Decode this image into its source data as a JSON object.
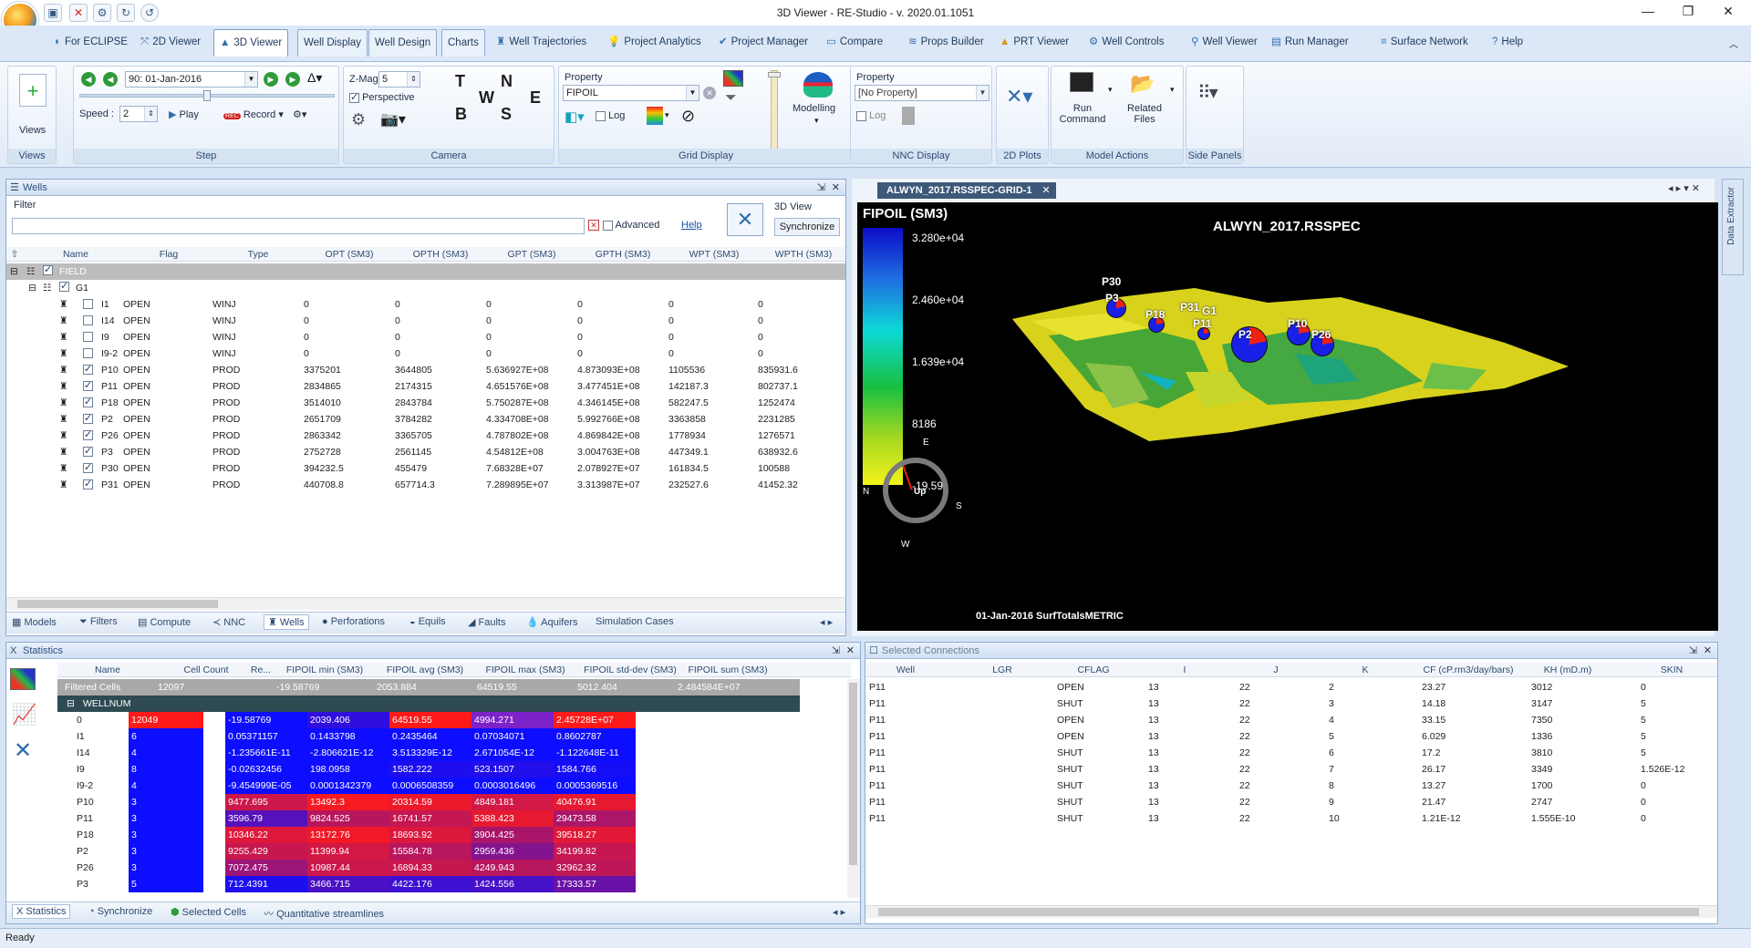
{
  "window": {
    "title": "3D Viewer - RE-Studio - v. 2020.01.1051"
  },
  "tabs": [
    {
      "label": "For ECLIPSE",
      "icon": "eclipse-icon"
    },
    {
      "label": "2D Viewer",
      "icon": "2d-viewer-icon"
    },
    {
      "label": "3D Viewer",
      "icon": "3d-viewer-icon"
    },
    {
      "label": "Well Display",
      "icon": ""
    },
    {
      "label": "Well Design",
      "icon": ""
    },
    {
      "label": "Charts",
      "icon": ""
    },
    {
      "label": "Well Trajectories",
      "icon": "derrick-icon"
    },
    {
      "label": "Project Analytics",
      "icon": "bulb-icon"
    },
    {
      "label": "Project Manager",
      "icon": "manager-icon"
    },
    {
      "label": "Compare",
      "icon": "compare-icon"
    },
    {
      "label": "Props Builder",
      "icon": "props-icon"
    },
    {
      "label": "PRT Viewer",
      "icon": "prt-icon"
    },
    {
      "label": "Well Controls",
      "icon": "controls-icon"
    },
    {
      "label": "Well Viewer",
      "icon": "well-viewer-icon"
    },
    {
      "label": "Run Manager",
      "icon": "server-icon"
    },
    {
      "label": "Surface Network",
      "icon": "network-icon"
    },
    {
      "label": "Help",
      "icon": "help-icon"
    }
  ],
  "ribbon": {
    "views_label": "Views",
    "views_group": "Views",
    "step_date": "90: 01-Jan-2016",
    "speed_label": "Speed :",
    "speed_value": "2",
    "play_label": "Play",
    "record_label": "Record",
    "step_group": "Step",
    "zmag_label": "Z-Mag",
    "zmag_value": "5",
    "perspective_label": "Perspective",
    "compass_letters": [
      "T",
      "B",
      "W",
      "N",
      "S",
      "E"
    ],
    "camera_group": "Camera",
    "property_label": "Property",
    "property_value": "FIPOIL",
    "log_label": "Log",
    "modelling_label": "Modelling",
    "grid_group": "Grid Display",
    "nnc_property_label": "Property",
    "nnc_property_value": "[No Property]",
    "nnc_log_label": "Log",
    "nnc_group": "NNC Display",
    "plots_group": "2D Plots",
    "run_command": "Run\nCommand",
    "related_files": "Related\nFiles",
    "actions_group": "Model Actions",
    "side_group": "Side Panels"
  },
  "wells_panel": {
    "title": "Wells",
    "filter_label": "Filter",
    "filter_value": "",
    "advanced_label": "Advanced",
    "help_label": "Help",
    "view_label": "3D View",
    "sync_label": "Synchronize",
    "columns": [
      "Name",
      "Flag",
      "Type",
      "OPT (SM3)",
      "OPTH (SM3)",
      "GPT (SM3)",
      "GPTH (SM3)",
      "WPT (SM3)",
      "WPTH (SM3)"
    ],
    "field_label": "FIELD",
    "group_label": "G1",
    "rows": [
      [
        "I1",
        "OPEN",
        "WINJ",
        "0",
        "0",
        "0",
        "0",
        "0",
        "0"
      ],
      [
        "I14",
        "OPEN",
        "WINJ",
        "0",
        "0",
        "0",
        "0",
        "0",
        "0"
      ],
      [
        "I9",
        "OPEN",
        "WINJ",
        "0",
        "0",
        "0",
        "0",
        "0",
        "0"
      ],
      [
        "I9-2",
        "OPEN",
        "WINJ",
        "0",
        "0",
        "0",
        "0",
        "0",
        "0"
      ],
      [
        "P10",
        "OPEN",
        "PROD",
        "3375201",
        "3644805",
        "5.636927E+08",
        "4.873093E+08",
        "1105536",
        "835931.6"
      ],
      [
        "P11",
        "OPEN",
        "PROD",
        "2834865",
        "2174315",
        "4.651576E+08",
        "3.477451E+08",
        "142187.3",
        "802737.1"
      ],
      [
        "P18",
        "OPEN",
        "PROD",
        "3514010",
        "2843784",
        "5.750287E+08",
        "4.346145E+08",
        "582247.5",
        "1252474"
      ],
      [
        "P2",
        "OPEN",
        "PROD",
        "2651709",
        "3784282",
        "4.334708E+08",
        "5.992766E+08",
        "3363858",
        "2231285"
      ],
      [
        "P26",
        "OPEN",
        "PROD",
        "2863342",
        "3365705",
        "4.787802E+08",
        "4.869842E+08",
        "1778934",
        "1276571"
      ],
      [
        "P3",
        "OPEN",
        "PROD",
        "2752728",
        "2561145",
        "4.54812E+08",
        "3.004763E+08",
        "447349.1",
        "638932.6"
      ],
      [
        "P30",
        "OPEN",
        "PROD",
        "394232.5",
        "455479",
        "7.68328E+07",
        "2.078927E+07",
        "161834.5",
        "100588"
      ],
      [
        "P31",
        "OPEN",
        "PROD",
        "440708.8",
        "657714.3",
        "7.289895E+07",
        "3.313987E+07",
        "232527.6",
        "41452.32"
      ]
    ],
    "checked": [
      false,
      false,
      false,
      false,
      true,
      true,
      true,
      true,
      true,
      true,
      true,
      true
    ],
    "bottom_tabs": [
      "Models",
      "Filters",
      "Compute",
      "NNC",
      "Wells",
      "Perforations",
      "Equils",
      "Faults",
      "Aquifers",
      "Simulation Cases"
    ]
  },
  "viewer": {
    "tab_label": "ALWYN_2017.RSSPEC-GRID-1",
    "property_title": "FIPOIL (SM3)",
    "model_title": "ALWYN_2017.RSSPEC",
    "legend": [
      "3.280e+04",
      "2.460e+04",
      "1.639e+04",
      "8186",
      "-19.59"
    ],
    "footer": "01-Jan-2016 SurfTotalsMETRIC",
    "compass": {
      "n": "N",
      "e": "E",
      "s": "S",
      "w": "W",
      "up": "Up"
    },
    "wells": [
      "P30",
      "P3",
      "P18",
      "P31",
      "G1",
      "P11",
      "P2",
      "P10",
      "P26"
    ],
    "side_label": "Data Extractor"
  },
  "stats_panel": {
    "title": "Statistics",
    "columns": [
      "Name",
      "Cell Count",
      "Re...",
      "FIPOIL min (SM3)",
      "FIPOIL avg (SM3)",
      "FIPOIL max (SM3)",
      "FIPOIL std-dev (SM3)",
      "FIPOIL sum (SM3)"
    ],
    "filtered": [
      "Filtered Cells",
      "12097",
      "",
      "-19.58769",
      "2053.884",
      "64519.55",
      "5012.404",
      "2.484584E+07"
    ],
    "group": "WELLNUM",
    "rows": [
      [
        "0",
        "12049",
        "",
        "-19.58769",
        "2039.406",
        "64519.55",
        "4994.271",
        "2.45728E+07"
      ],
      [
        "I1",
        "6",
        "",
        "0.05371157",
        "0.1433798",
        "0.2435464",
        "0.07034071",
        "0.8602787"
      ],
      [
        "I14",
        "4",
        "",
        "-1.235661E-11",
        "-2.806621E-12",
        "3.513329E-12",
        "2.671054E-12",
        "-1.122648E-11"
      ],
      [
        "I9",
        "8",
        "",
        "-0.02632456",
        "198.0958",
        "1582.222",
        "523.1507",
        "1584.766"
      ],
      [
        "I9-2",
        "4",
        "",
        "-9.454999E-05",
        "0.0001342379",
        "0.0006508359",
        "0.0003016496",
        "0.0005369516"
      ],
      [
        "P10",
        "3",
        "",
        "9477.695",
        "13492.3",
        "20314.59",
        "4849.181",
        "40476.91"
      ],
      [
        "P11",
        "3",
        "",
        "3596.79",
        "9824.525",
        "16741.57",
        "5388.423",
        "29473.58"
      ],
      [
        "P18",
        "3",
        "",
        "10346.22",
        "13172.76",
        "18693.92",
        "3904.425",
        "39518.27"
      ],
      [
        "P2",
        "3",
        "",
        "9255.429",
        "11399.94",
        "15584.78",
        "2959.436",
        "34199.82"
      ],
      [
        "P26",
        "3",
        "",
        "7072.475",
        "10987.44",
        "16894.33",
        "4249.943",
        "32962.32"
      ],
      [
        "P3",
        "5",
        "",
        "712.4391",
        "3466.715",
        "4422.176",
        "1424.556",
        "17333.57"
      ]
    ],
    "bottom_tabs": [
      "Statistics",
      "Synchronize",
      "Selected Cells",
      "Quantitative streamlines"
    ]
  },
  "conn_panel": {
    "title": "Selected Connections",
    "columns": [
      "Well",
      "LGR",
      "CFLAG",
      "I",
      "J",
      "K",
      "CF (cP.rm3/day/bars)",
      "KH (mD.m)",
      "SKIN"
    ],
    "rows": [
      [
        "P11",
        "",
        "OPEN",
        "13",
        "22",
        "2",
        "23.27",
        "3012",
        "0"
      ],
      [
        "P11",
        "",
        "SHUT",
        "13",
        "22",
        "3",
        "14.18",
        "3147",
        "5"
      ],
      [
        "P11",
        "",
        "OPEN",
        "13",
        "22",
        "4",
        "33.15",
        "7350",
        "5"
      ],
      [
        "P11",
        "",
        "OPEN",
        "13",
        "22",
        "5",
        "6.029",
        "1336",
        "5"
      ],
      [
        "P11",
        "",
        "SHUT",
        "13",
        "22",
        "6",
        "17.2",
        "3810",
        "5"
      ],
      [
        "P11",
        "",
        "SHUT",
        "13",
        "22",
        "7",
        "26.17",
        "3349",
        "1.526E-12"
      ],
      [
        "P11",
        "",
        "SHUT",
        "13",
        "22",
        "8",
        "13.27",
        "1700",
        "0"
      ],
      [
        "P11",
        "",
        "SHUT",
        "13",
        "22",
        "9",
        "21.47",
        "2747",
        "0"
      ],
      [
        "P11",
        "",
        "SHUT",
        "13",
        "22",
        "10",
        "1.21E-12",
        "1.555E-10",
        "0"
      ]
    ]
  },
  "status": "Ready",
  "colors": {
    "accent": "#2f6db0",
    "red": "#ff1a1a",
    "blue": "#0d0dff"
  }
}
